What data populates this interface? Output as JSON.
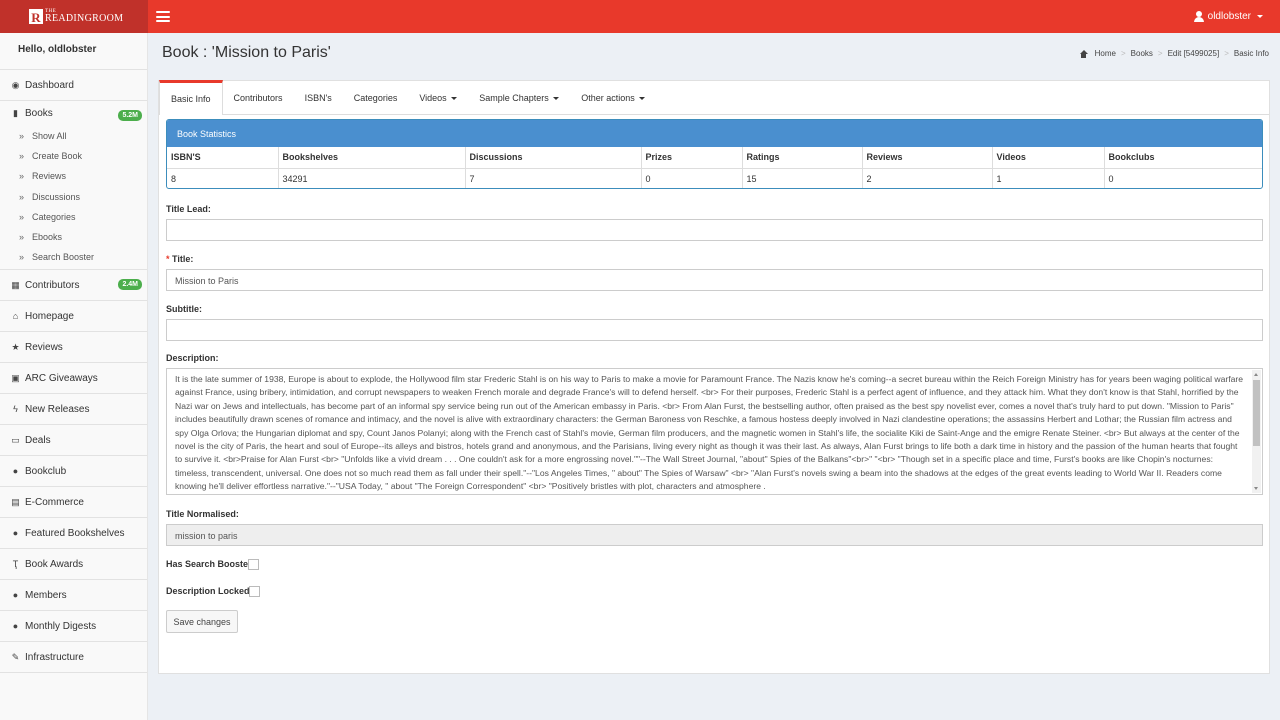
{
  "brand": {
    "logo_letter": "R",
    "small": "THE",
    "big": "READINGROOM"
  },
  "user": {
    "name": "oldlobster"
  },
  "sidebar": {
    "greeting": "Hello, oldlobster",
    "items": [
      {
        "label": "Dashboard",
        "icon": "dashboard-icon"
      },
      {
        "label": "Books",
        "icon": "book-icon",
        "badge": "5.2M"
      },
      {
        "label": "Contributors",
        "icon": "grid-icon",
        "badge": "2.4M"
      },
      {
        "label": "Homepage",
        "icon": "home-icon"
      },
      {
        "label": "Reviews",
        "icon": "star-icon"
      },
      {
        "label": "ARC Giveaways",
        "icon": "gift-icon"
      },
      {
        "label": "New Releases",
        "icon": "bolt-icon"
      },
      {
        "label": "Deals",
        "icon": "money-icon"
      },
      {
        "label": "Bookclub",
        "icon": "users-icon"
      },
      {
        "label": "E-Commerce",
        "icon": "cart-icon"
      },
      {
        "label": "Featured Bookshelves",
        "icon": "user-icon"
      },
      {
        "label": "Book Awards",
        "icon": "trophy-icon"
      },
      {
        "label": "Members",
        "icon": "user-icon"
      },
      {
        "label": "Monthly Digests",
        "icon": "user-icon"
      },
      {
        "label": "Infrastructure",
        "icon": "wrench-icon"
      }
    ],
    "books_sub": [
      "Show All",
      "Create Book",
      "Reviews",
      "Discussions",
      "Categories",
      "Ebooks",
      "Search Booster"
    ]
  },
  "page": {
    "title": "Book : 'Mission to Paris'",
    "breadcrumb": [
      "Home",
      "Books",
      "Edit [5499025]",
      "Basic Info"
    ]
  },
  "tabs": [
    "Basic Info",
    "Contributors",
    "ISBN's",
    "Categories",
    "Videos",
    "Sample Chapters",
    "Other actions"
  ],
  "stats": {
    "heading": "Book Statistics",
    "columns": [
      "ISBN'S",
      "Bookshelves",
      "Discussions",
      "Prizes",
      "Ratings",
      "Reviews",
      "Videos",
      "Bookclubs"
    ],
    "values": [
      "8",
      "34291",
      "7",
      "0",
      "15",
      "2",
      "1",
      "0"
    ]
  },
  "form": {
    "title_lead_label": "Title Lead:",
    "title_lead_value": "",
    "title_label": "Title:",
    "title_required_mark": "*",
    "title_value": "Mission to Paris",
    "subtitle_label": "Subtitle:",
    "subtitle_value": "",
    "description_label": "Description:",
    "description_value": "It is the late summer of 1938, Europe is about to explode, the Hollywood film star Frederic Stahl is on his way to Paris to make a movie for Paramount France. The Nazis know he's coming--a secret bureau within the Reich Foreign Ministry has for years been waging political warfare against France, using bribery, intimidation, and corrupt newspapers to weaken French morale and degrade France's will to defend herself. <br> For their purposes, Frederic Stahl is a perfect agent of influence, and they attack him. What they don't know is that Stahl, horrified by the Nazi war on Jews and intellectuals, has become part of an informal spy service being run out of the American embassy in Paris. <br> From Alan Furst, the bestselling author, often praised as the best spy novelist ever, comes a novel that's truly hard to put down. \"Mission to Paris\" includes beautifully drawn scenes of romance and intimacy, and the novel is alive with extraordinary characters: the German Baroness von Reschke, a famous hostess deeply involved in Nazi clandestine operations; the assassins Herbert and Lothar; the Russian film actress and spy Olga Orlova; the Hungarian diplomat and spy, Count Janos Polanyi; along with the French cast of Stahl's movie, German film producers, and the magnetic women in Stahl's life, the socialite Kiki de Saint-Ange and the emigre Renate Steiner. <br> But always at the center of the novel is the city of Paris, the heart and soul of Europe--its alleys and bistros, hotels grand and anonymous, and the Parisians, living every night as though it was their last. As always, Alan Furst brings to life both a dark time in history and the passion of the human hearts that fought to survive it. <br>Praise for Alan Furst <br> \"Unfolds like a vivid dream . . . One couldn't ask for a more engrossing novel.\"\"--The Wall Street Journal, \"about\" Spies of the Balkans\"<br>\" \"<br> \"Though set in a specific place and time, Furst's books are like Chopin's nocturnes: timeless, transcendent, universal. One does not so much read them as fall under their spell.\"--\"Los Angeles Times, \" about\" The Spies of Warsaw\" <br> \"Alan Furst's novels swing a beam into the shadows at the edges of the great events leading to World War II. Readers come knowing he'll deliver effortless narrative.\"--\"USA Today, \" about \"The Foreign Correspondent\" <br> \"Positively bristles with plot, characters and atmosphere .",
    "title_normalised_label": "Title Normalised:",
    "title_normalised_value": "mission to paris",
    "search_booster_label": "Has Search Booster?",
    "description_locked_label": "Description Locked?",
    "save_label": "Save changes"
  }
}
